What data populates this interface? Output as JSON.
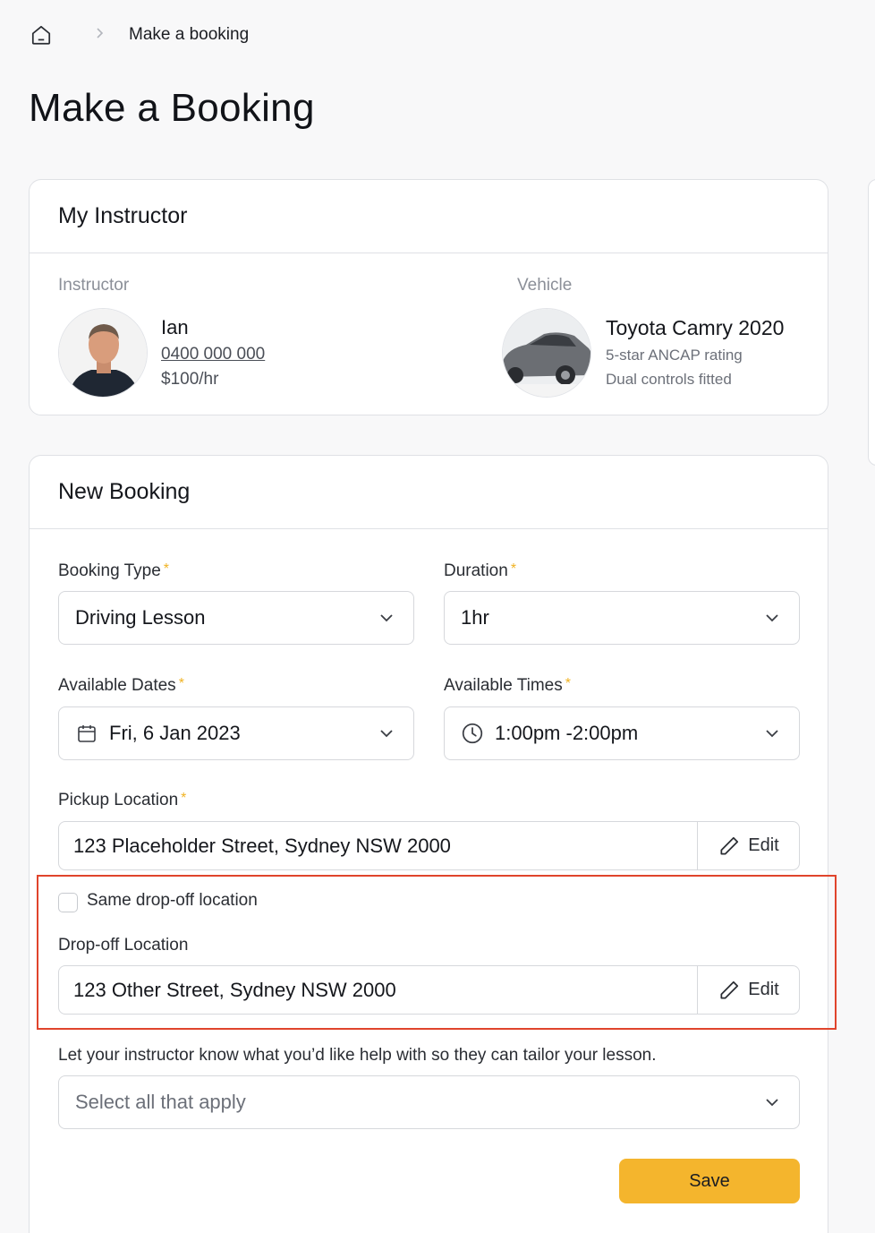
{
  "breadcrumb": {
    "current": "Make a booking"
  },
  "page": {
    "title": "Make a Booking"
  },
  "instructor_card": {
    "title": "My Instructor",
    "instructor_label": "Instructor",
    "vehicle_label": "Vehicle",
    "instructor": {
      "name": "Ian",
      "phone": "0400 000 000",
      "rate": "$100/hr"
    },
    "vehicle": {
      "name": "Toyota Camry 2020",
      "rating": "5-star ANCAP rating",
      "feature": "Dual controls fitted"
    }
  },
  "booking_card": {
    "title": "New Booking",
    "booking_type": {
      "label": "Booking Type",
      "required": "*",
      "value": "Driving Lesson"
    },
    "duration": {
      "label": "Duration",
      "required": "*",
      "value": "1hr"
    },
    "dates": {
      "label": "Available Dates",
      "required": "*",
      "value": "Fri, 6 Jan 2023"
    },
    "times": {
      "label": "Available Times",
      "required": "*",
      "value": "1:00pm -2:00pm"
    },
    "pickup": {
      "label": "Pickup Location",
      "required": "*",
      "value": "123 Placeholder Street, Sydney NSW 2000",
      "edit": "Edit"
    },
    "same_dropoff": {
      "label": "Same drop-off location",
      "checked": false
    },
    "dropoff": {
      "label": "Drop-off Location",
      "value": "123 Other Street, Sydney NSW 2000",
      "edit": "Edit"
    },
    "help": {
      "text": "Let your instructor know what you’d like help with so they can tailor your lesson.",
      "placeholder": "Select all that apply"
    },
    "save": "Save"
  },
  "colors": {
    "accent": "#f4b52d",
    "highlight": "#e0442c",
    "required": "#f0b323"
  }
}
